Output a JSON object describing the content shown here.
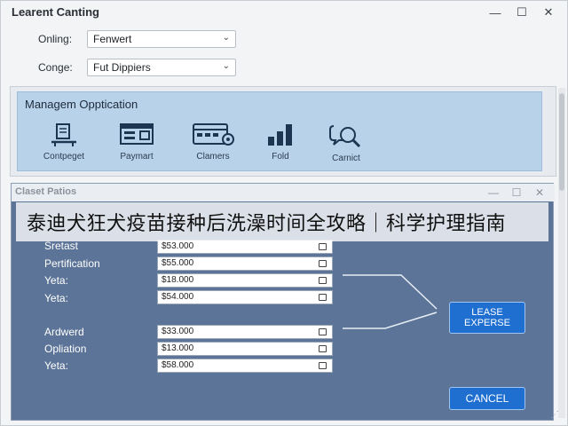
{
  "window": {
    "title": "Learent Canting",
    "minimize": "—",
    "maximize": "☐",
    "close": "✕"
  },
  "fields": [
    {
      "label": "Onling:",
      "value": "Fenwert"
    },
    {
      "label": "Conge:",
      "value": "Fut Dippiers"
    }
  ],
  "management": {
    "title": "Managem Opptication",
    "tools": [
      {
        "label": "Contpeget",
        "icon": "desk-icon"
      },
      {
        "label": "Paymart",
        "icon": "payment-table-icon"
      },
      {
        "label": "Clamers",
        "icon": "cards-gear-icon"
      },
      {
        "label": "Fold",
        "icon": "bar-chart-icon"
      },
      {
        "label": "Carnict",
        "icon": "chat-magnifier-icon"
      }
    ]
  },
  "dialog": {
    "title": "Claset Patios",
    "minimize": "—",
    "maximize": "☐",
    "close": "✕",
    "rows_top": [
      {
        "label": "Sretast",
        "value": "$53.000"
      },
      {
        "label": "Pertification",
        "value": "$55.000"
      },
      {
        "label": "Yeta:",
        "value": "$18.000"
      },
      {
        "label": "Yeta:",
        "value": "$54.000"
      }
    ],
    "rows_bottom": [
      {
        "label": "Ardwerd",
        "value": "$33.000"
      },
      {
        "label": "Opliation",
        "value": "$13.000"
      },
      {
        "label": "Yeta:",
        "value": "$58.000"
      }
    ],
    "lease_button": {
      "line1": "LEASE",
      "line2": "EXPERSE"
    },
    "cancel_button": "CANCEL"
  },
  "caption": "泰迪犬狂犬疫苗接种后洗澡时间全攻略｜科学护理指南",
  "colors": {
    "panel_blue": "#b8d2ea",
    "dialog_bg": "#5c7497",
    "button_blue": "#1f6fd1"
  }
}
